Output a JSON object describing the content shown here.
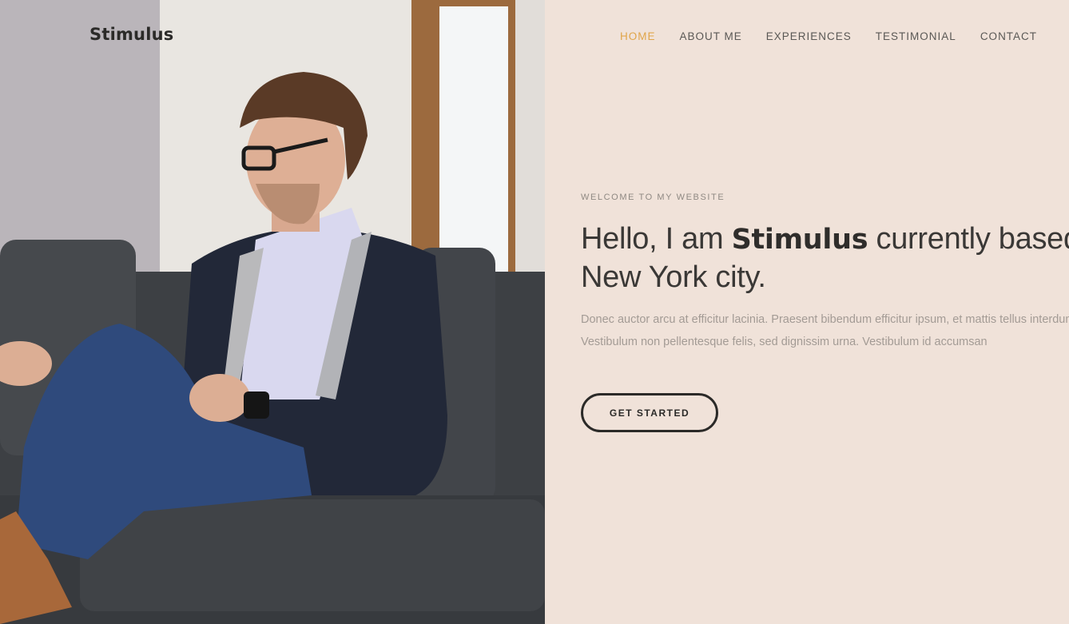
{
  "brand": {
    "name": "Stimulus"
  },
  "nav": {
    "items": [
      {
        "label": "HOME",
        "active": true
      },
      {
        "label": "ABOUT ME",
        "active": false
      },
      {
        "label": "EXPERIENCES",
        "active": false
      },
      {
        "label": "TESTIMONIAL",
        "active": false
      },
      {
        "label": "CONTACT",
        "active": false
      }
    ]
  },
  "hero": {
    "eyebrow": "WELCOME TO MY WEBSITE",
    "headline_pre": "Hello, I am ",
    "headline_name": "Stimulus",
    "headline_post": " currently based in New York city.",
    "body": "Donec auctor arcu at efficitur lacinia. Praesent bibendum efficitur ipsum, et mattis tellus interdum dictum purus. Vestibulum non pellentesque felis, sed dignissim urna. Vestibulum id accumsan",
    "cta_label": "GET STARTED"
  },
  "colors": {
    "background": "#f0e2d9",
    "accent": "#e0a54a",
    "text_dark": "#2b2a28"
  }
}
